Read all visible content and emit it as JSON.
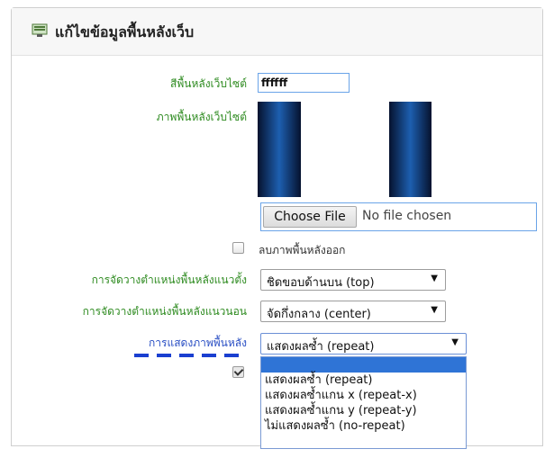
{
  "header": {
    "title": "แก้ไขข้อมูลพื้นหลังเว็บ",
    "icon": "edit-form-icon"
  },
  "form": {
    "bg_color_label": "สีพื้นหลังเว็บไซต์",
    "bg_color_value": "ffffff",
    "bg_image_label": "ภาพพื้นหลังเว็บไซต์",
    "choose_file_label": "Choose File",
    "file_status": "No file chosen",
    "remove_bg_label": "ลบภาพพื้นหลังออก",
    "vertical_label": "การจัดวางตำแหน่งพื้นหลังแนวตั้ง",
    "vertical_value": "ชิดขอบด้านบน (top)",
    "horizontal_label": "การจัดวางตำแหน่งพื้นหลังแนวนอน",
    "horizontal_value": "จัดกึ่งกลาง (center)",
    "display_label": "การแสดงภาพพื้นหลัง",
    "display_value": "แสดงผลซ้ำ (repeat)"
  },
  "dropdown": {
    "options": [
      "",
      "แสดงผลซ้ำ (repeat)",
      "แสดงผลซ้ำแกน x (repeat-x)",
      "แสดงผลซ้ำแกน y (repeat-y)",
      "ไม่แสดงผลซ้ำ (no-repeat)"
    ],
    "highlighted_index": 0
  },
  "colors": {
    "label_green": "#2e8b20",
    "label_blue": "#2a4fc4",
    "highlight": "#2f74d6",
    "annotation": "#1a3fd0"
  }
}
